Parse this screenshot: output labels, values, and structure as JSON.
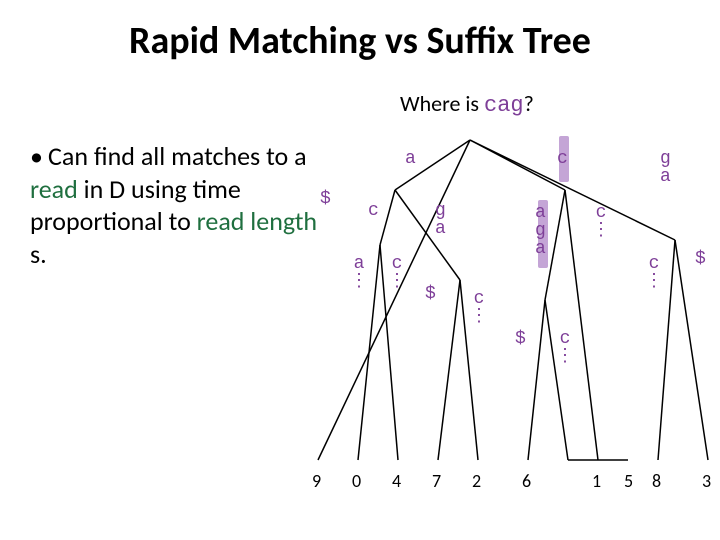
{
  "title": "Rapid Matching vs Suffix Tree",
  "where": {
    "prefix": "Where is ",
    "query": "cag",
    "suffix": "?"
  },
  "bullet": {
    "dot": "•",
    "t1": "Can find all matches to a ",
    "read": "read",
    "t2": " in D using time proportional to ",
    "rlen": "read length",
    "t3": " s."
  },
  "edges": {
    "e_dollar": "$",
    "e_a": "a",
    "e_c": "c",
    "e_ga": "g\na",
    "e_a_c": "c",
    "e_a_g": "g\na",
    "e_a_adots": "a\n⋮",
    "e_a_cdots": "c\n⋮",
    "e_a_gdollar": "$",
    "e_a_gcdots": "c\n⋮",
    "e_c_a": "a\ng\na",
    "e_c_cdots": "c\n⋮",
    "e_c_a_dollar": "$",
    "e_c_a_cdots": "c\n⋮",
    "e_ga_cdots": "c\n⋮",
    "e_ga_dollar": "$"
  },
  "leaves": [
    "9",
    "0",
    "4",
    "7",
    "2",
    "6",
    "1",
    "5",
    "8",
    "3"
  ]
}
